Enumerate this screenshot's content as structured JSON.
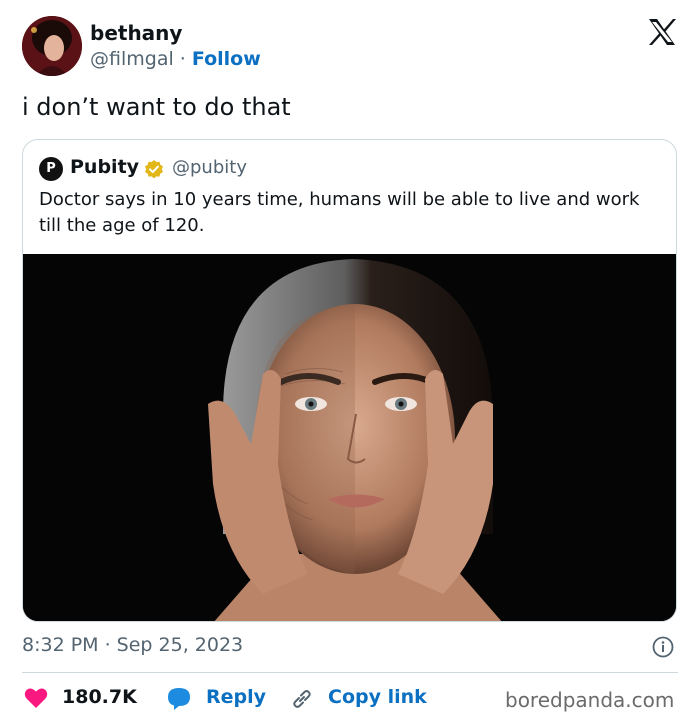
{
  "author": {
    "name": "bethany",
    "handle": "@filmgal",
    "separator": "·",
    "follow_label": "Follow"
  },
  "tweet": {
    "text": "i don’t want to do that"
  },
  "quoted": {
    "avatar_letter": "P",
    "name": "Pubity",
    "handle": "@pubity",
    "text": "Doctor says in 10 years time, humans will be able to live and work till the age of 120."
  },
  "meta": {
    "timestamp": "8:32 PM · Sep 25, 2023"
  },
  "actions": {
    "likes": "180.7K",
    "reply_label": "Reply",
    "copy_link_label": "Copy link"
  },
  "watermark": "boredpanda.com",
  "colors": {
    "accent": "#0b6fc2",
    "like": "#f91880",
    "verified": "#e2b719",
    "muted": "#536471"
  },
  "icons": {
    "logo": "x-logo-icon",
    "verified": "verified-badge-icon",
    "info": "info-icon",
    "like": "heart-icon",
    "reply": "speech-bubble-icon",
    "copy": "link-icon"
  }
}
